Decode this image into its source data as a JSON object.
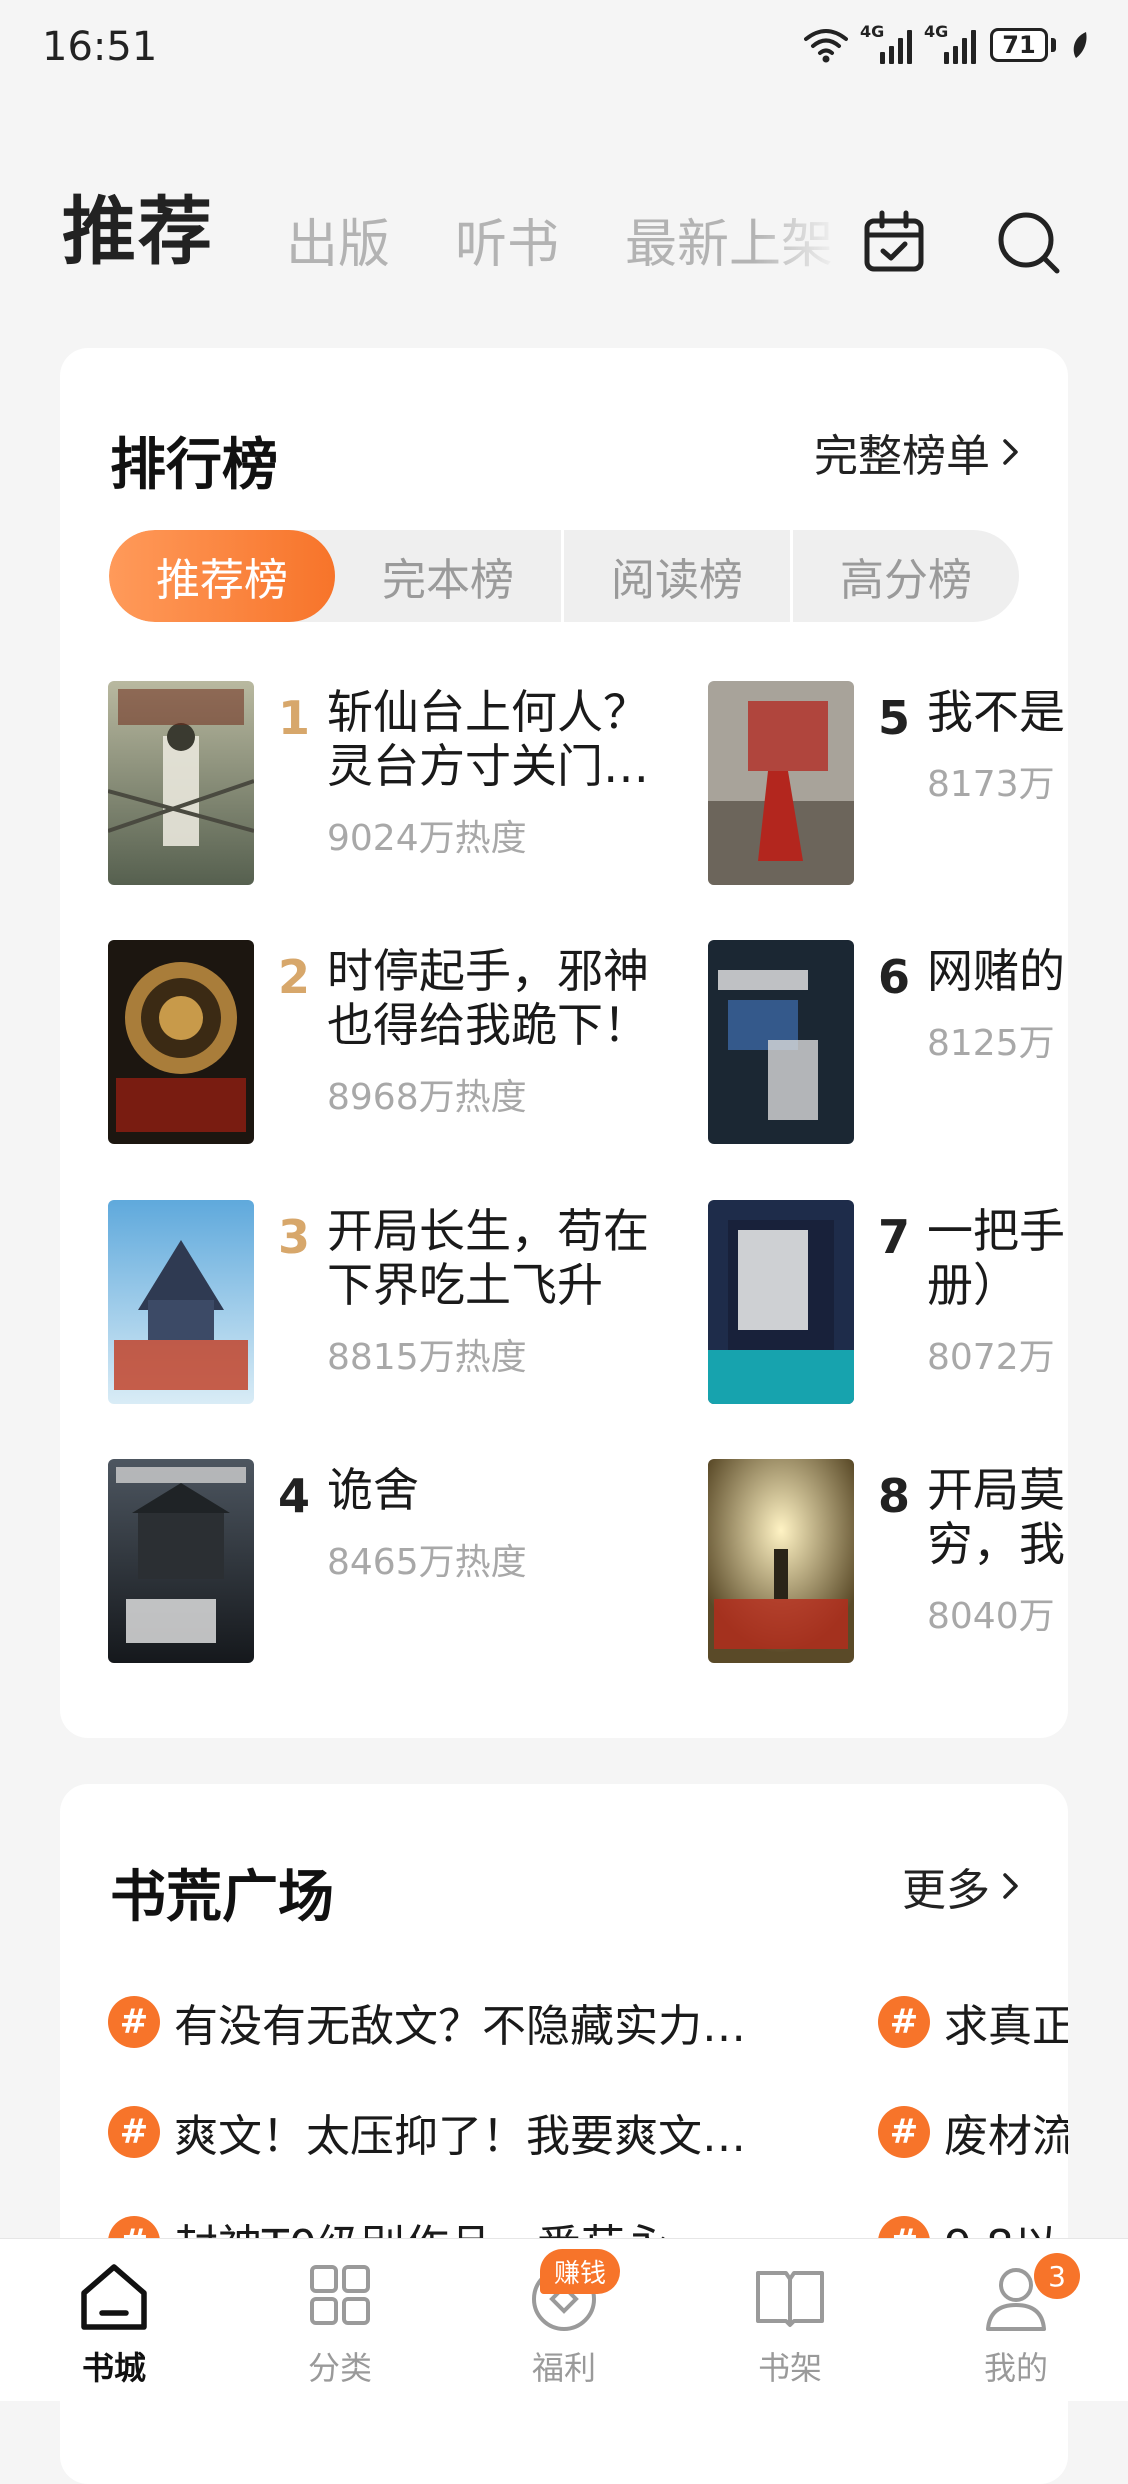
{
  "status_bar": {
    "time": "16:51",
    "network_1": "4G",
    "network_2": "4G",
    "battery": "71"
  },
  "top_nav": {
    "active_tab": "推荐",
    "tabs": [
      "出版",
      "听书",
      "最新上架"
    ],
    "icons": [
      "calendar-check-icon",
      "search-icon"
    ]
  },
  "ranking": {
    "title": "排行榜",
    "more_label": "完整榜单",
    "tabs": [
      "推荐榜",
      "完本榜",
      "阅读榜",
      "高分榜"
    ],
    "active_tab": "推荐榜",
    "books": [
      {
        "rank": "1",
        "title": "斩仙台上何人？灵台方寸关门…",
        "heat": "9024万热度"
      },
      {
        "rank": "2",
        "title": "时停起手，邪神也得给我跪下！",
        "heat": "8968万热度"
      },
      {
        "rank": "3",
        "title": "开局长生，苟在下界吃土飞升",
        "heat": "8815万热度"
      },
      {
        "rank": "4",
        "title": "诡舍",
        "heat": "8465万热度"
      },
      {
        "rank": "5",
        "title": "我不是",
        "heat": "8173万"
      },
      {
        "rank": "6",
        "title": "网赌的",
        "heat": "8125万"
      },
      {
        "rank": "7",
        "title": "一把手册）",
        "heat": "8072万"
      },
      {
        "rank": "8",
        "title": "开局莫穷，我",
        "heat": "8040万"
      }
    ]
  },
  "plaza": {
    "title": "书荒广场",
    "more_label": "更多",
    "topics_left": [
      "有没有无敌文？不隐藏实力…",
      "爽文！太压抑了！我要爽文…",
      "封神T0级别作品，番茄永…"
    ],
    "topics_right": [
      "求真正",
      "废材流",
      "9.8以"
    ]
  },
  "bottom_nav": {
    "items": [
      "书城",
      "分类",
      "福利",
      "书架",
      "我的"
    ],
    "active": "书城",
    "earn_badge": "赚钱",
    "profile_badge": "3"
  },
  "colors": {
    "accent": "#f7742a",
    "rank_gold": "#d7a76b",
    "background": "#f5f5f5"
  }
}
